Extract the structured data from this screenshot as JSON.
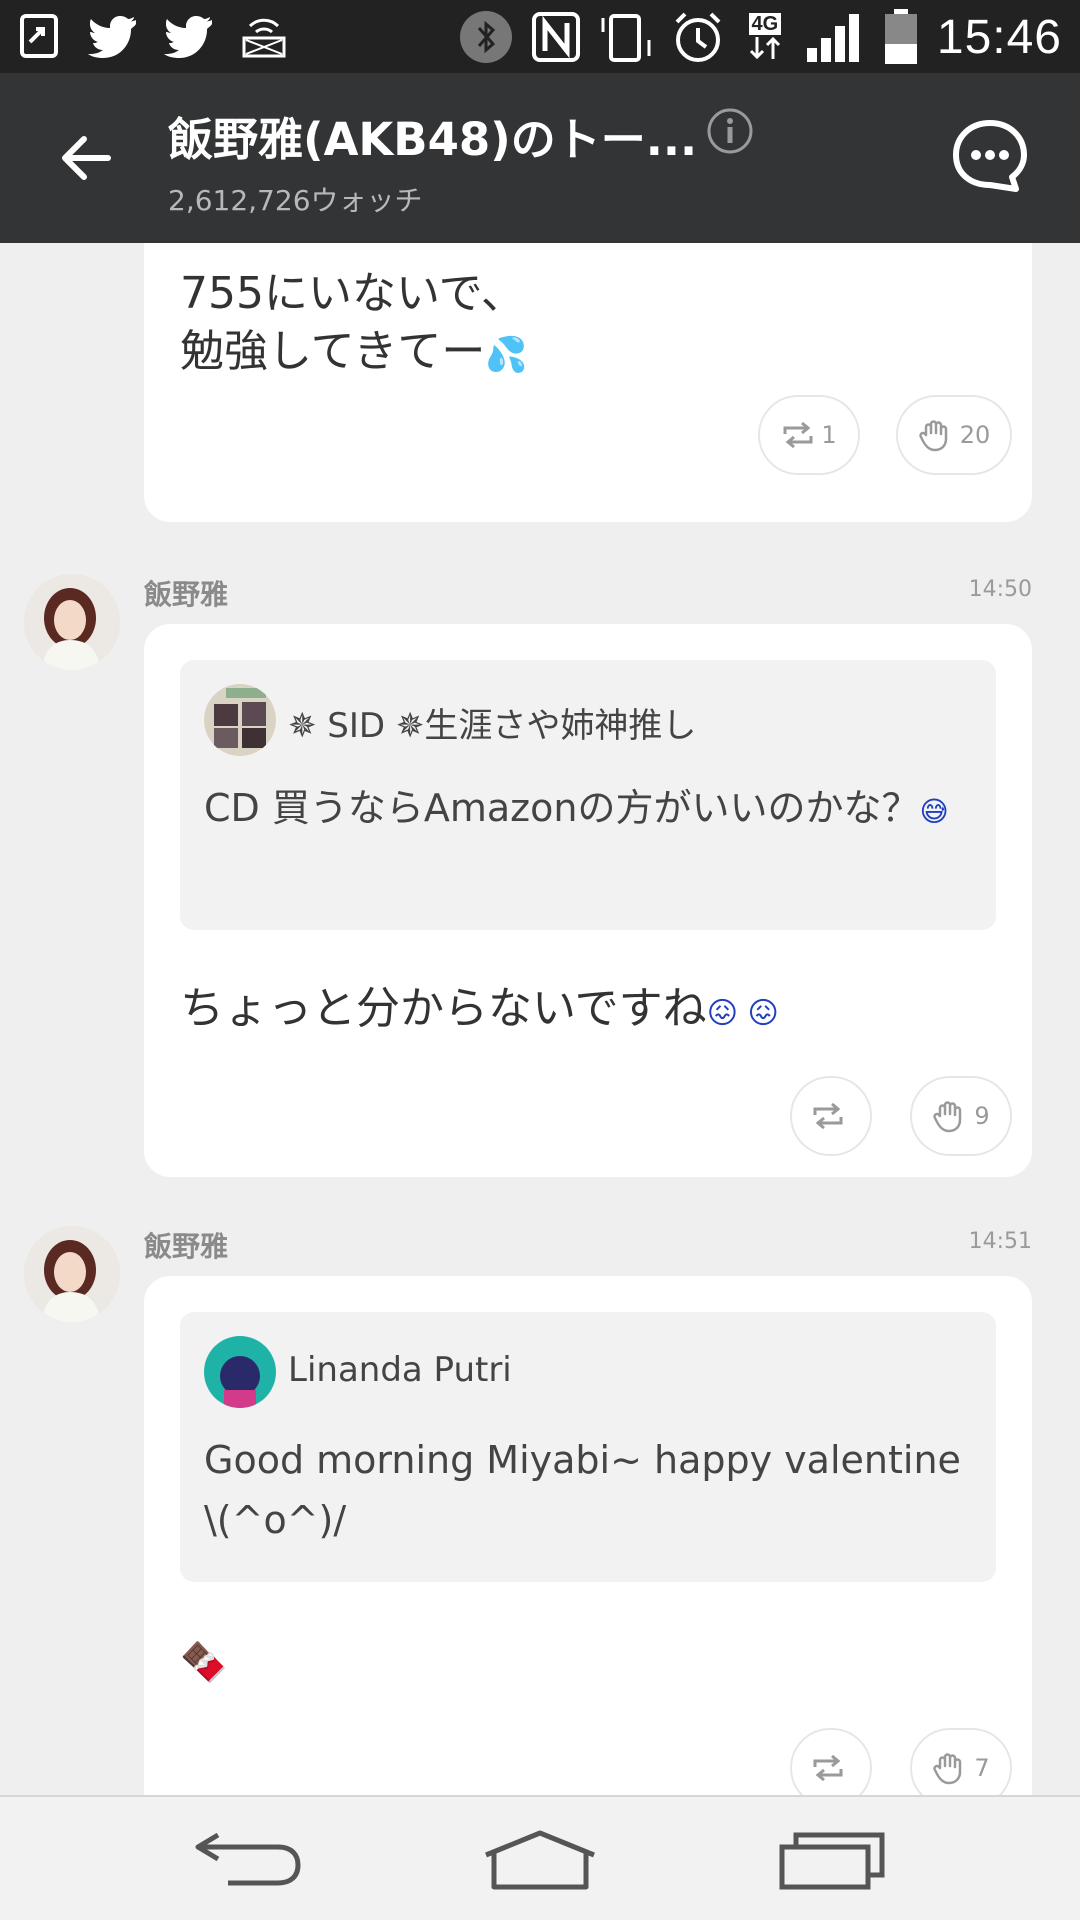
{
  "status_bar": {
    "time": "15:46",
    "network": "4G",
    "left_icons": [
      "screen-share-icon",
      "twitter-icon",
      "twitter-icon",
      "sim-tray-icon"
    ],
    "right_icons": [
      "bluetooth-icon",
      "nfc-icon",
      "vibrate-icon",
      "alarm-icon",
      "network-4g-icon",
      "signal-icon",
      "battery-icon"
    ]
  },
  "header": {
    "title": "飯野雅(AKB48)のトー...",
    "watch_count": "2,612,726ウォッチ"
  },
  "posts": [
    {
      "text_line1": "755にいないで、",
      "text_line2": "勉強してきてー",
      "emoji": "💦",
      "repost_count": "1",
      "like_count": "20"
    },
    {
      "author": "飯野雅",
      "time": "14:50",
      "quote_name": "✵ SID ✵生涯さや姉神推し",
      "quote_text": "CD 買うならAmazonの方がいいのかな？",
      "quote_emoji": "😅",
      "text": "ちょっと分からないですね",
      "emoji": "😖 😖",
      "repost_count": "",
      "like_count": "9"
    },
    {
      "author": "飯野雅",
      "time": "14:51",
      "quote_name": "Linanda Putri",
      "quote_text": "Good morning Miyabi~ happy valentine \\(^o^)/",
      "text": "🍫",
      "repost_count": "",
      "like_count": "7"
    }
  ],
  "colors": {
    "appbar": "#333435",
    "statusbar": "#222222",
    "background": "#efefef",
    "card": "#ffffff",
    "quote": "#f2f2f2",
    "emoji_blue": "#1f3fbf"
  }
}
